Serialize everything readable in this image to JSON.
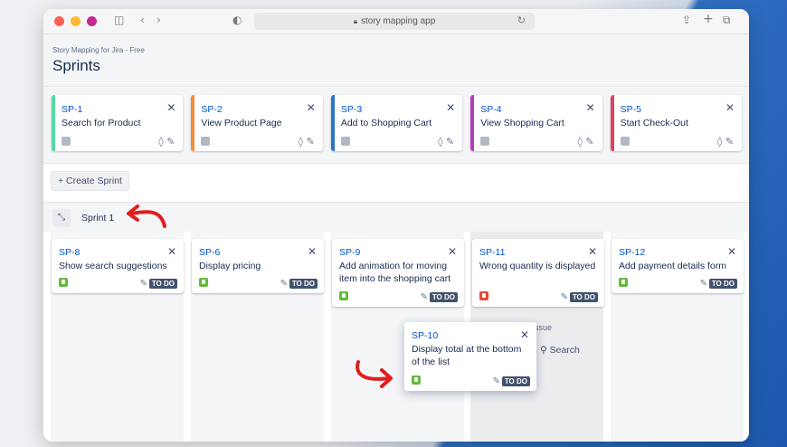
{
  "browser": {
    "url": "story mapping app"
  },
  "header": {
    "app_name": "Story Mapping for Jira - Free",
    "title": "Sprints"
  },
  "epics": [
    {
      "key": "SP-1",
      "summary": "Search for Product",
      "color": "#57d9a3"
    },
    {
      "key": "SP-2",
      "summary": "View Product Page",
      "color": "#f18d3c"
    },
    {
      "key": "SP-3",
      "summary": "Add to Shopping Cart",
      "color": "#2a74c9"
    },
    {
      "key": "SP-4",
      "summary": "View Shopping Cart",
      "color": "#b23fb4"
    },
    {
      "key": "SP-5",
      "summary": "Start Check-Out",
      "color": "#e0435b"
    }
  ],
  "create_sprint_label": "+ Create Sprint",
  "sprint": {
    "name": "Sprint 1"
  },
  "issues": [
    {
      "key": "SP-8",
      "summary": "Show search suggestions",
      "type": "story",
      "status": "TO DO"
    },
    {
      "key": "SP-6",
      "summary": "Display pricing",
      "type": "story",
      "status": "TO DO"
    },
    {
      "key": "SP-9",
      "summary": "Add animation for moving item into the shopping cart",
      "type": "story",
      "status": "TO DO"
    },
    {
      "key": "SP-11",
      "summary": "Wrong quantity is displayed",
      "type": "bug",
      "status": "TO DO"
    },
    {
      "key": "SP-12",
      "summary": "Add payment details form",
      "type": "story",
      "status": "TO DO"
    },
    {
      "key": "SP-10",
      "summary": "Display total at the bottom of the list",
      "type": "story",
      "status": "TO DO"
    }
  ],
  "ghost": {
    "issue_label": "issue",
    "search_label": "Search"
  },
  "icons": {
    "close": "close-icon",
    "edit": "pencil-icon",
    "collapse": "collapse-icon"
  }
}
